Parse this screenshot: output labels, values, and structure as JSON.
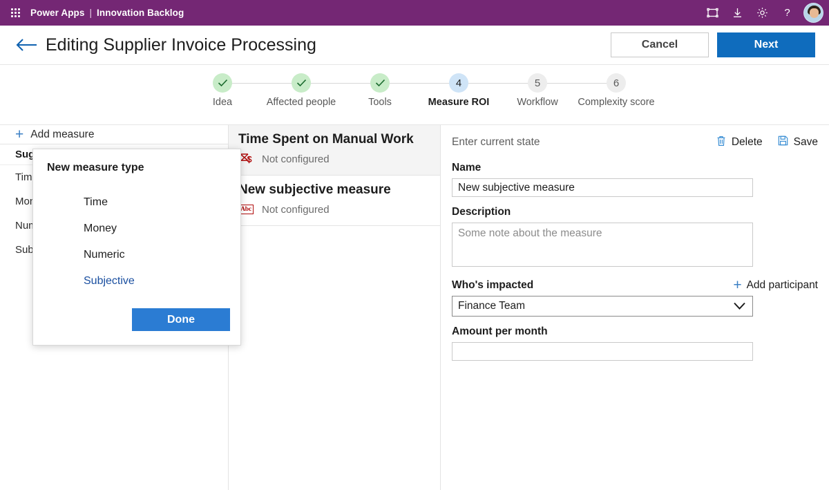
{
  "suitebar": {
    "waffle_label": "app-launcher",
    "product": "Power Apps",
    "separator": "|",
    "app_name": "Innovation Backlog",
    "icons": [
      "fullscreen-icon",
      "download-icon",
      "gear-icon",
      "help-icon",
      "avatar"
    ]
  },
  "header": {
    "back_label": "back-arrow",
    "title": "Editing Supplier Invoice Processing",
    "cancel_label": "Cancel",
    "next_label": "Next"
  },
  "stepper": {
    "steps": [
      {
        "number": "1",
        "label": "Idea",
        "state": "done",
        "mark": "✓"
      },
      {
        "number": "2",
        "label": "Affected people",
        "state": "done",
        "mark": "✓"
      },
      {
        "number": "3",
        "label": "Tools",
        "state": "done",
        "mark": "✓"
      },
      {
        "number": "4",
        "label": "Measure ROI",
        "state": "current",
        "mark": "4"
      },
      {
        "number": "5",
        "label": "Workflow",
        "state": "todo",
        "mark": "5"
      },
      {
        "number": "6",
        "label": "Complexity score",
        "state": "todo",
        "mark": "6"
      }
    ]
  },
  "left_panel": {
    "add_measure_label": "Add measure",
    "list_header": "Suggested",
    "items": [
      {
        "label": "Time"
      },
      {
        "label": "Money"
      },
      {
        "label": "Numeric"
      },
      {
        "label": "Subjective"
      }
    ]
  },
  "popup": {
    "title": "New measure type",
    "options": [
      {
        "label": "Time",
        "selected": false
      },
      {
        "label": "Money",
        "selected": false
      },
      {
        "label": "Numeric",
        "selected": false
      },
      {
        "label": "Subjective",
        "selected": true
      }
    ],
    "done_label": "Done"
  },
  "measures": [
    {
      "name": "Time Spent on Manual Work",
      "status": "Not configured",
      "icon": "hourglass-dollar-icon",
      "active": true
    },
    {
      "name": "New subjective measure",
      "status": "Not configured",
      "icon": "abc-text-icon",
      "active": false
    }
  ],
  "detail_panel": {
    "title": "Enter current state",
    "delete_label": "Delete",
    "save_label": "Save",
    "name_label": "Name",
    "name_value": "New subjective measure",
    "description_label": "Description",
    "description_value": "",
    "description_placeholder": "Some note about the measure",
    "impacted_label": "Who's impacted",
    "add_participant_label": "Add participant",
    "impacted_value": "Finance Team",
    "amount_label": "Amount per month",
    "amount_value": "",
    "amount_placeholder": ""
  },
  "colors": {
    "suitebar_purple": "#742774",
    "primary_blue": "#0f6cbd",
    "accent_blue": "#2b7cd3",
    "step_done_green": "#c8ecc8",
    "step_current_blue": "#cfe4f7",
    "icon_red": "#b00b0b"
  }
}
